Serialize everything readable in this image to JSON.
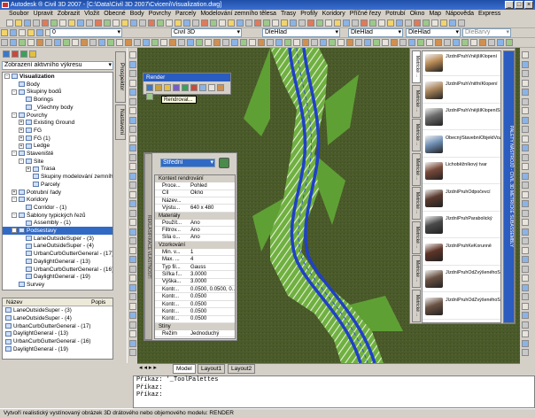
{
  "window": {
    "title": "Autodesk ® Civil 3D 2007 - [C:\\Data\\Civil 3D 2007\\Cviceni\\Visualization.dwg]"
  },
  "menu": [
    "Soubor",
    "Upravit",
    "Zobrazit",
    "Vložit",
    "Obecné",
    "Body",
    "Povrchy",
    "Parcely",
    "Modelování zemního tělesa",
    "Trasy",
    "Profily",
    "Koridory",
    "Příčné řezy",
    "Potrubí",
    "Okno",
    "Map",
    "Nápověda",
    "Express"
  ],
  "toolbar": {
    "layer_combo": "0",
    "style_combo": "Civil 3D",
    "linetype_combo": "DleHlad",
    "lineweight_combo": "DleHlad",
    "color_combo": "DleHlad",
    "plot_combo": "DleBarvy"
  },
  "prospector": {
    "view_combo": "Zobrazení aktivního výkresu",
    "side_tab_1": "Prospektor",
    "side_tab_2": "Nastavení",
    "tree": [
      {
        "label": "Visualization",
        "depth": 0,
        "exp": "-",
        "bold": true
      },
      {
        "label": "Body",
        "depth": 1,
        "exp": ""
      },
      {
        "label": "Skupiny bodů",
        "depth": 1,
        "exp": "-"
      },
      {
        "label": "Borings",
        "depth": 2,
        "exp": ""
      },
      {
        "label": "_Všechny body",
        "depth": 2,
        "exp": ""
      },
      {
        "label": "Povrchy",
        "depth": 1,
        "exp": "-"
      },
      {
        "label": "Existing Ground",
        "depth": 2,
        "exp": "+"
      },
      {
        "label": "FG",
        "depth": 2,
        "exp": "+"
      },
      {
        "label": "FG (1)",
        "depth": 2,
        "exp": "+"
      },
      {
        "label": "Ledge",
        "depth": 2,
        "exp": "+"
      },
      {
        "label": "Staveniště",
        "depth": 1,
        "exp": "-"
      },
      {
        "label": "Site",
        "depth": 2,
        "exp": "-"
      },
      {
        "label": "Trasa",
        "depth": 3,
        "exp": "+"
      },
      {
        "label": "Skupiny modelování zemního tělesa",
        "depth": 3,
        "exp": ""
      },
      {
        "label": "Parcely",
        "depth": 3,
        "exp": ""
      },
      {
        "label": "Potrubní řady",
        "depth": 1,
        "exp": "+"
      },
      {
        "label": "Koridory",
        "depth": 1,
        "exp": "-"
      },
      {
        "label": "Corridor - (1)",
        "depth": 2,
        "exp": ""
      },
      {
        "label": "Šablony typických řezů",
        "depth": 1,
        "exp": "-"
      },
      {
        "label": "Assembly - (1)",
        "depth": 2,
        "exp": ""
      },
      {
        "label": "Podsestavy",
        "depth": 1,
        "exp": "-",
        "selected": true
      },
      {
        "label": "LaneOutsideSuper - (3)",
        "depth": 2,
        "exp": ""
      },
      {
        "label": "LaneOutsideSuper - (4)",
        "depth": 2,
        "exp": ""
      },
      {
        "label": "UrbanCurbGutterGeneral - (17)",
        "depth": 2,
        "exp": ""
      },
      {
        "label": "DaylightGeneral - (13)",
        "depth": 2,
        "exp": ""
      },
      {
        "label": "UrbanCurbGutterGeneral - (16)",
        "depth": 2,
        "exp": ""
      },
      {
        "label": "DaylightGeneral - (19)",
        "depth": 2,
        "exp": ""
      },
      {
        "label": "Survey",
        "depth": 1,
        "exp": ""
      }
    ],
    "list_headers": [
      "Název",
      "Popis"
    ],
    "list_rows": [
      "LaneOutsideSuper - (3)",
      "LaneOutsideSuper - (4)",
      "UrbanCurbGutterGeneral - (17)",
      "DaylightGeneral - (13)",
      "UrbanCurbGutterGeneral - (16)",
      "DaylightGeneral - (19)"
    ]
  },
  "render_toolbar": {
    "title": "Render",
    "tooltip": "Rendrovat..."
  },
  "properties": {
    "preset_combo": "Střední",
    "rows": [
      {
        "cat": "Kontext rendrování"
      },
      {
        "k": "Proce...",
        "v": "Pohled"
      },
      {
        "k": "Cíl",
        "v": "Okno"
      },
      {
        "k": "Název...",
        "v": ""
      },
      {
        "k": "Výstu...",
        "v": "640 x 480"
      },
      {
        "cat": "Materiály"
      },
      {
        "k": "Použít...",
        "v": "Ano"
      },
      {
        "k": "Filtrov...",
        "v": "Ano"
      },
      {
        "k": "Síla o...",
        "v": "Ano"
      },
      {
        "cat": "Vzorkování"
      },
      {
        "k": "Min. v...",
        "v": "1"
      },
      {
        "k": "Max. ...",
        "v": "4"
      },
      {
        "k": "Typ fil...",
        "v": "Gauss"
      },
      {
        "k": "Šířka f...",
        "v": "3.0000"
      },
      {
        "k": "Výška...",
        "v": "3.0000"
      },
      {
        "k": "Kontr...",
        "v": "0.0500, 0.0500, 0..."
      },
      {
        "k": "Kontr...",
        "v": "0.0500"
      },
      {
        "k": "Kontr...",
        "v": "0.0500"
      },
      {
        "k": "Kontr...",
        "v": "0.0500"
      },
      {
        "k": "Kontr...",
        "v": "0.0500"
      },
      {
        "cat": "Stíny"
      },
      {
        "k": "Režim",
        "v": "Jednoduchý"
      }
    ],
    "side_label": "REKLASIFIKACE VLASTNOSTÍ"
  },
  "palette": {
    "tabs": [
      "Metrické ...",
      "Metrické ...",
      "Metrické ...",
      "Metrické ...",
      "Metrické ...",
      "Metrické ...",
      "Metrické ...",
      "Metrické ..."
    ],
    "items": [
      {
        "label": "JízdníPruhVnějšíKlopení",
        "color": "#b98a56"
      },
      {
        "label": "JízdníPruhVnitřníKlopení",
        "color": "#a9855b"
      },
      {
        "label": "JízdníPruhVnějšíKlopeníSKrustferem",
        "color": "#6b6b6b"
      },
      {
        "label": "ObecnýStavebníObjektVozovky",
        "color": "#6f8fb5"
      },
      {
        "label": "Lichoběžníkový tvar",
        "color": "#7a4a3a"
      },
      {
        "label": "JízdníPruhOdpočevcí",
        "color": "#5b3a2f"
      },
      {
        "label": "JízdníPruhParabolický",
        "color": "#4a4a4a"
      },
      {
        "label": "JízdníPruhKeKorunně",
        "color": "#5f3427"
      },
      {
        "label": "JízdníPruhOdZvýšenéhoStředníhoDělicíhoPásu1",
        "color": "#6a5243"
      },
      {
        "label": "JízdníPruhOdZvýšenéhoStředníhoDělicíhoPásu2",
        "color": "#6a5243"
      }
    ],
    "side_label": "PALETY NÁSTROJŮ - CIVIL 3D METRICKÉ SUBASSEMBLY"
  },
  "layout_tabs": [
    "Model",
    "Layout1",
    "Layout2"
  ],
  "command": {
    "line1": "Příkaz: '_ToolPalettes",
    "line2": "Příkaz:",
    "line3": "Příkaz:"
  },
  "status": "Vytvoří realistický vystínovaný obrázek 3D drátového nebo objemového modelu: RENDER",
  "colors": {
    "terrain": "#4a5a2a",
    "road_blue": "#2040c8",
    "corridor_green": "#6fb040",
    "selection": "#316ac5",
    "title_blue": "#2b5cbf"
  }
}
